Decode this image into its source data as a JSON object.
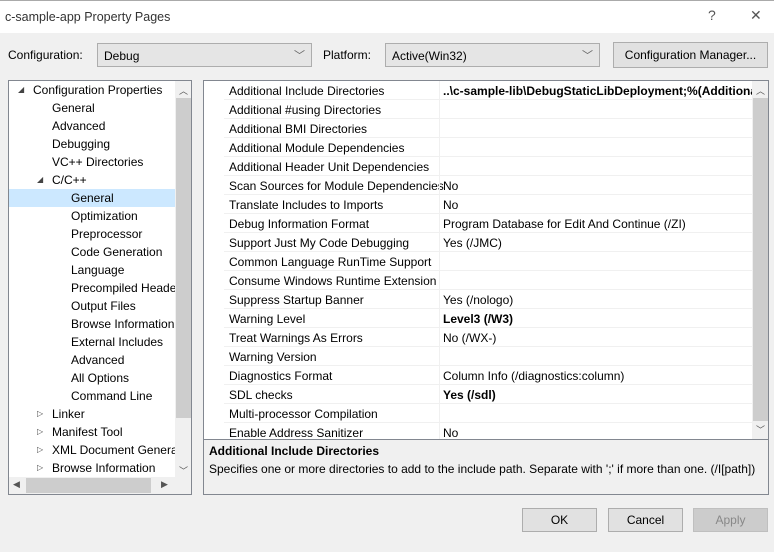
{
  "window": {
    "title": "c-sample-app Property Pages",
    "help": "?",
    "close": "✕"
  },
  "config": {
    "label": "Configuration:",
    "value": "Debug",
    "platform_label": "Platform:",
    "platform_value": "Active(Win32)",
    "manager_button": "Configuration Manager..."
  },
  "tree": [
    {
      "label": "Configuration Properties",
      "level": 0,
      "arrow": "expanded"
    },
    {
      "label": "General",
      "level": 1
    },
    {
      "label": "Advanced",
      "level": 1
    },
    {
      "label": "Debugging",
      "level": 1
    },
    {
      "label": "VC++ Directories",
      "level": 1
    },
    {
      "label": "C/C++",
      "level": 1,
      "arrow": "expanded"
    },
    {
      "label": "General",
      "level": 2,
      "selected": true
    },
    {
      "label": "Optimization",
      "level": 2
    },
    {
      "label": "Preprocessor",
      "level": 2
    },
    {
      "label": "Code Generation",
      "level": 2
    },
    {
      "label": "Language",
      "level": 2
    },
    {
      "label": "Precompiled Headers",
      "level": 2
    },
    {
      "label": "Output Files",
      "level": 2
    },
    {
      "label": "Browse Information",
      "level": 2
    },
    {
      "label": "External Includes",
      "level": 2
    },
    {
      "label": "Advanced",
      "level": 2
    },
    {
      "label": "All Options",
      "level": 2
    },
    {
      "label": "Command Line",
      "level": 2
    },
    {
      "label": "Linker",
      "level": 1,
      "arrow": "collapsed"
    },
    {
      "label": "Manifest Tool",
      "level": 1,
      "arrow": "collapsed"
    },
    {
      "label": "XML Document Generator",
      "level": 1,
      "arrow": "collapsed"
    },
    {
      "label": "Browse Information",
      "level": 1,
      "arrow": "collapsed"
    }
  ],
  "properties": [
    {
      "name": "Additional Include Directories",
      "value": "..\\c-sample-lib\\DebugStaticLibDeployment;%(AdditionalIncludeDirectories)",
      "bold": true
    },
    {
      "name": "Additional #using Directories",
      "value": ""
    },
    {
      "name": "Additional BMI Directories",
      "value": ""
    },
    {
      "name": "Additional Module Dependencies",
      "value": ""
    },
    {
      "name": "Additional Header Unit Dependencies",
      "value": ""
    },
    {
      "name": "Scan Sources for Module Dependencies",
      "value": "No"
    },
    {
      "name": "Translate Includes to Imports",
      "value": "No"
    },
    {
      "name": "Debug Information Format",
      "value": "Program Database for Edit And Continue (/ZI)"
    },
    {
      "name": "Support Just My Code Debugging",
      "value": "Yes (/JMC)"
    },
    {
      "name": "Common Language RunTime Support",
      "value": ""
    },
    {
      "name": "Consume Windows Runtime Extension",
      "value": ""
    },
    {
      "name": "Suppress Startup Banner",
      "value": "Yes (/nologo)"
    },
    {
      "name": "Warning Level",
      "value": "Level3 (/W3)",
      "bold": true
    },
    {
      "name": "Treat Warnings As Errors",
      "value": "No (/WX-)"
    },
    {
      "name": "Warning Version",
      "value": ""
    },
    {
      "name": "Diagnostics Format",
      "value": "Column Info (/diagnostics:column)"
    },
    {
      "name": "SDL checks",
      "value": "Yes (/sdl)",
      "bold": true
    },
    {
      "name": "Multi-processor Compilation",
      "value": ""
    },
    {
      "name": "Enable Address Sanitizer",
      "value": "No"
    }
  ],
  "description": {
    "title": "Additional Include Directories",
    "text": "Specifies one or more directories to add to the include path. Separate with ';' if more than one. (/I[path])"
  },
  "buttons": {
    "ok": "OK",
    "cancel": "Cancel",
    "apply": "Apply"
  }
}
